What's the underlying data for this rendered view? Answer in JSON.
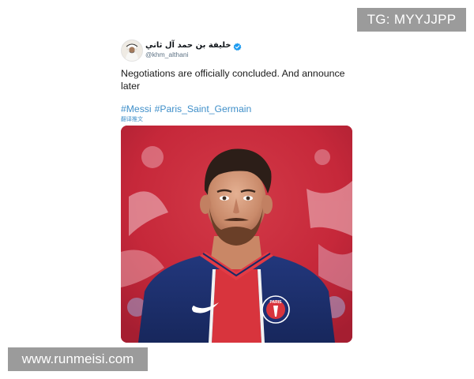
{
  "watermarks": {
    "top_right": "TG: MYYJJPP",
    "bottom_left": "www.runmeisi.com"
  },
  "tweet": {
    "display_name": "خليفة بن حمد آل ثاني",
    "handle": "@khm_althani",
    "verified": true,
    "text": "Negotiations are officially concluded. And announce later",
    "hashtags": [
      "#Messi",
      "#Paris_Saint_Germain"
    ],
    "translate_label": "翻译推文"
  },
  "media": {
    "crest_text": "PARIS",
    "colors": {
      "background_red": "#c6283a",
      "jersey_navy": "#1b2d6b",
      "jersey_red": "#d8343d",
      "hashtag_blue": "#3f8fc9"
    }
  }
}
